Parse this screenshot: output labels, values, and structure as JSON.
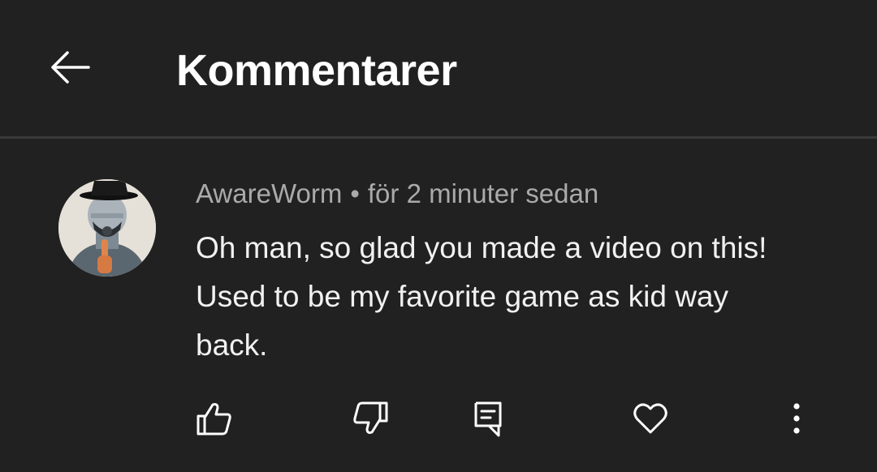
{
  "header": {
    "title": "Kommentarer"
  },
  "comment": {
    "author": "AwareWorm",
    "separator": "•",
    "timestamp": "för 2 minuter sedan",
    "text": "Oh man, so glad you made a video on this! Used to be my favorite game as kid way back."
  },
  "icons": {
    "back": "arrow-left-icon",
    "like": "thumbs-up-icon",
    "dislike": "thumbs-down-icon",
    "reply": "reply-comment-icon",
    "heart": "heart-icon",
    "more": "more-vertical-icon"
  },
  "colors": {
    "background": "#212121",
    "text": "#f1f1f1",
    "secondary_text": "#aaaaaa",
    "divider": "#3a3a3a"
  }
}
